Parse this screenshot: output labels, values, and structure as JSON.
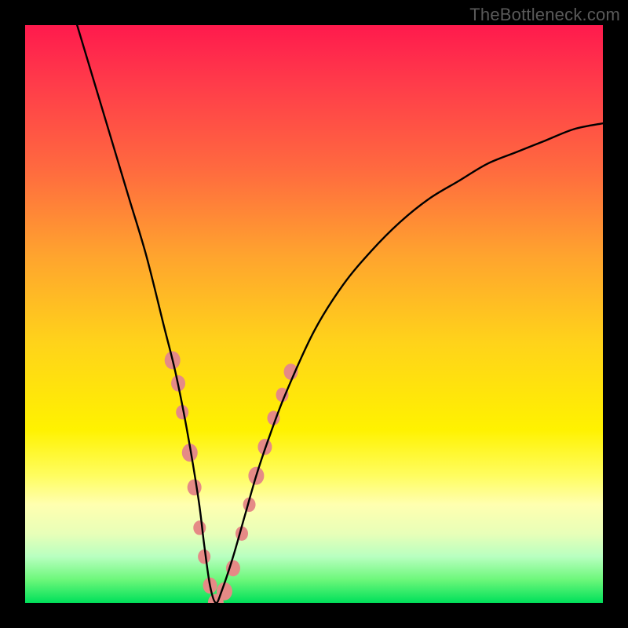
{
  "watermark": "TheBottleneck.com",
  "chart_data": {
    "type": "line",
    "title": "",
    "xlabel": "",
    "ylabel": "",
    "xlim": [
      0,
      100
    ],
    "ylim": [
      0,
      100
    ],
    "series": [
      {
        "name": "bottleneck-curve",
        "x": [
          9,
          12,
          15,
          18,
          21,
          24,
          26,
          28,
          30,
          31,
          32,
          33,
          34,
          36,
          38,
          40,
          42,
          45,
          50,
          55,
          60,
          65,
          70,
          75,
          80,
          85,
          90,
          95,
          100
        ],
        "values": [
          100,
          90,
          80,
          70,
          60,
          48,
          40,
          30,
          18,
          10,
          3,
          0,
          2,
          8,
          15,
          22,
          28,
          36,
          47,
          55,
          61,
          66,
          70,
          73,
          76,
          78,
          80,
          82,
          83
        ]
      }
    ],
    "markers": {
      "name": "highlight-points",
      "color": "#e58a86",
      "points": [
        {
          "x": 25.5,
          "y": 42,
          "r": 10
        },
        {
          "x": 26.5,
          "y": 38,
          "r": 9
        },
        {
          "x": 27.2,
          "y": 33,
          "r": 8
        },
        {
          "x": 28.5,
          "y": 26,
          "r": 10
        },
        {
          "x": 29.3,
          "y": 20,
          "r": 9
        },
        {
          "x": 30.2,
          "y": 13,
          "r": 8
        },
        {
          "x": 31.0,
          "y": 8,
          "r": 8
        },
        {
          "x": 32.0,
          "y": 3,
          "r": 9
        },
        {
          "x": 33.0,
          "y": 0,
          "r": 10
        },
        {
          "x": 34.5,
          "y": 2,
          "r": 10
        },
        {
          "x": 36.0,
          "y": 6,
          "r": 9
        },
        {
          "x": 37.5,
          "y": 12,
          "r": 8
        },
        {
          "x": 38.8,
          "y": 17,
          "r": 8
        },
        {
          "x": 40.0,
          "y": 22,
          "r": 10
        },
        {
          "x": 41.5,
          "y": 27,
          "r": 9
        },
        {
          "x": 43.0,
          "y": 32,
          "r": 8
        },
        {
          "x": 44.5,
          "y": 36,
          "r": 8
        },
        {
          "x": 46.0,
          "y": 40,
          "r": 9
        }
      ]
    }
  }
}
